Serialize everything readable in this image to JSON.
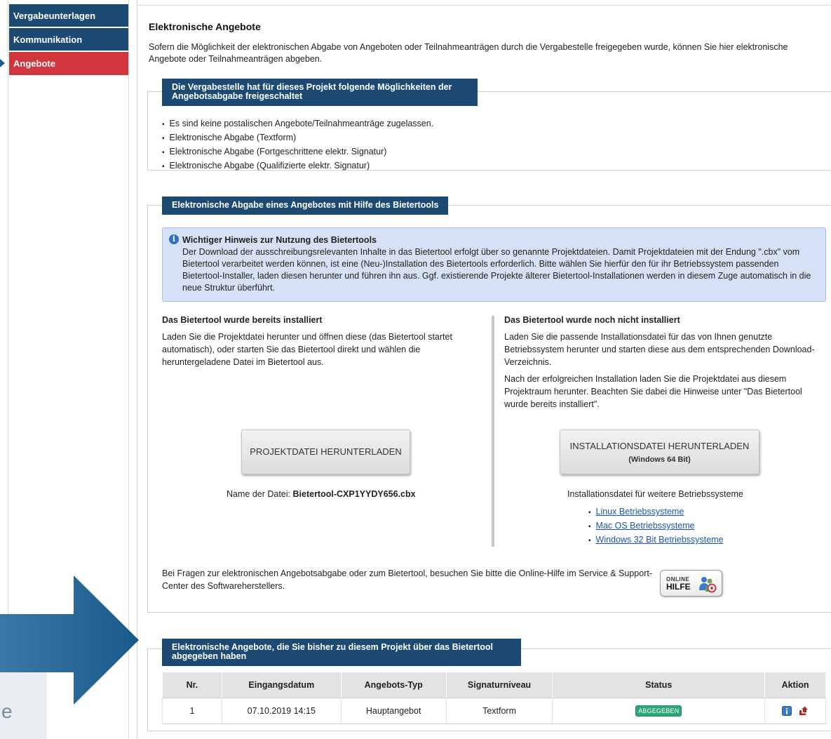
{
  "sidebar": {
    "items": [
      {
        "label": "Vergabeunterlagen"
      },
      {
        "label": "Kommunikation"
      },
      {
        "label": "Angebote"
      }
    ]
  },
  "overlay": {
    "lower_text": "e"
  },
  "page": {
    "title": "Elektronische Angebote",
    "intro": "Sofern die Möglichkeit der elektronischen Abgabe von Angeboten oder Teilnahmeanträgen durch die Vergabestelle freigegeben wurde, können Sie hier elektronische Angebote oder Teilnahmeanträgen abgeben."
  },
  "options": {
    "legend": "Die Vergabestelle hat für dieses Projekt folgende Möglichkeiten der Angebotsabgabe freigeschaltet",
    "items": [
      "Es sind keine postalischen Angebote/Teilnahmeanträge zugelassen.",
      "Elektronische Abgabe (Textform)",
      "Elektronische Abgabe (Fortgeschrittene elektr. Signatur)",
      "Elektronische Abgabe (Qualifizierte elektr. Signatur)"
    ]
  },
  "bietertool": {
    "legend": "Elektronische Abgabe eines Angebotes mit Hilfe des Bietertools",
    "info_title": "Wichtiger Hinweis zur Nutzung des Bietertools",
    "info_text": "Der Download der ausschreibungsrelevanten Inhalte in das Bietertool erfolgt über so genannte Projektdateien. Damit Projektdateien mit der Endung \".cbx\" vom Bietertool verarbeitet werden können, ist eine (Neu-)Installation des Bietertools erforderlich. Bitte wählen Sie hierfür den für ihr Betriebssystem passenden Bietertool-Installer, laden diesen herunter und führen ihn aus. Ggf. existierende Projekte älterer Bietertool-Installationen werden in diesem Zuge automatisch in die neue Struktur überführt.",
    "installed": {
      "title": "Das Bietertool wurde bereits installiert",
      "text": "Laden Sie die Projektdatei herunter und öffnen diese (das Bietertool startet automatisch), oder starten Sie das Bietertool direkt und wählen die heruntergeladene Datei im Bietertool aus.",
      "button": "PROJEKTDATEI HERUNTERLADEN",
      "filename_label": "Name der Datei:",
      "filename": "Bietertool-CXP1YYDY656.cbx"
    },
    "not_installed": {
      "title": "Das Bietertool wurde noch nicht installiert",
      "text1": "Laden Sie die passende Installationsdatei für das von Ihnen genutzte Betriebssystem herunter und starten diese aus dem entsprechenden Download-Verzeichnis.",
      "text2": "Nach der erfolgreichen Installation laden Sie die Projektdatei aus diesem Projektraum herunter. Beachten Sie dabei die Hinweise unter \"Das Bietertool wurde bereits installiert\".",
      "button": "INSTALLATIONSDATEI HERUNTERLADEN",
      "button_sub": "(Windows 64 Bit)",
      "other_label": "Installationsdatei für weitere Betriebssysteme",
      "links": [
        "Linux Betriebssysteme",
        "Mac OS Betriebssysteme",
        "Windows 32 Bit Betriebssysteme"
      ]
    },
    "help_text": "Bei Fragen zur elektronischen Angebotsabgabe oder zum Bietertool, besuchen Sie bitte die Online-Hilfe im Service & Support-Center des Softwareherstellers.",
    "help_button_line1": "ONLINE",
    "help_button_line2": "HILFE"
  },
  "submitted": {
    "legend": "Elektronische Angebote, die Sie bisher zu diesem Projekt über das Bietertool abgegeben haben",
    "headers": [
      "Nr.",
      "Eingangsdatum",
      "Angebots-Typ",
      "Signaturniveau",
      "Status",
      "Aktion"
    ],
    "rows": [
      {
        "nr": "1",
        "date": "07.10.2019 14:15",
        "type": "Hauptangebot",
        "signature": "Textform",
        "status": "ABGEGEBEN"
      }
    ]
  },
  "colors": {
    "nav_dark": "#1c4a72",
    "nav_active": "#d0363c",
    "status_green": "#2aa876",
    "overlay_arrow": "#1f5f8b"
  }
}
